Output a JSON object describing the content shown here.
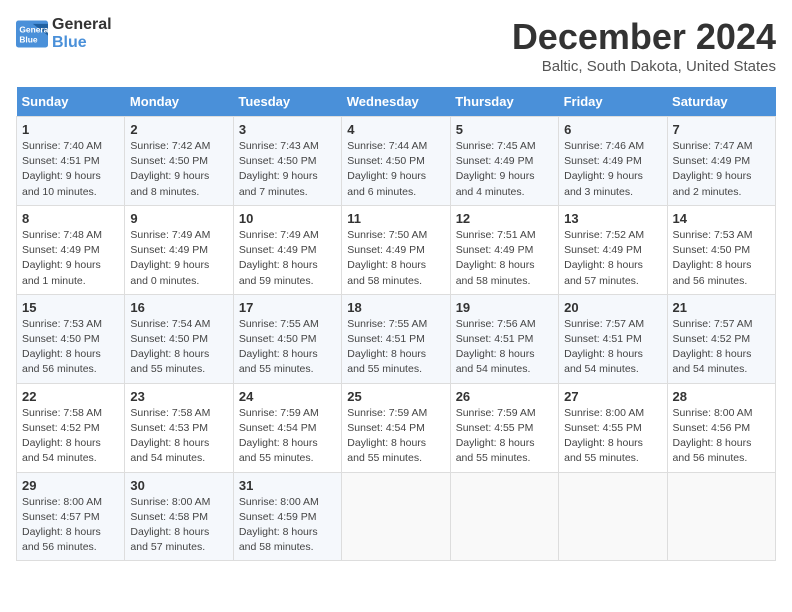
{
  "header": {
    "logo_line1": "General",
    "logo_line2": "Blue",
    "title": "December 2024",
    "subtitle": "Baltic, South Dakota, United States"
  },
  "days_of_week": [
    "Sunday",
    "Monday",
    "Tuesday",
    "Wednesday",
    "Thursday",
    "Friday",
    "Saturday"
  ],
  "weeks": [
    [
      {
        "day": 1,
        "info": "Sunrise: 7:40 AM\nSunset: 4:51 PM\nDaylight: 9 hours and 10 minutes."
      },
      {
        "day": 2,
        "info": "Sunrise: 7:42 AM\nSunset: 4:50 PM\nDaylight: 9 hours and 8 minutes."
      },
      {
        "day": 3,
        "info": "Sunrise: 7:43 AM\nSunset: 4:50 PM\nDaylight: 9 hours and 7 minutes."
      },
      {
        "day": 4,
        "info": "Sunrise: 7:44 AM\nSunset: 4:50 PM\nDaylight: 9 hours and 6 minutes."
      },
      {
        "day": 5,
        "info": "Sunrise: 7:45 AM\nSunset: 4:49 PM\nDaylight: 9 hours and 4 minutes."
      },
      {
        "day": 6,
        "info": "Sunrise: 7:46 AM\nSunset: 4:49 PM\nDaylight: 9 hours and 3 minutes."
      },
      {
        "day": 7,
        "info": "Sunrise: 7:47 AM\nSunset: 4:49 PM\nDaylight: 9 hours and 2 minutes."
      }
    ],
    [
      {
        "day": 8,
        "info": "Sunrise: 7:48 AM\nSunset: 4:49 PM\nDaylight: 9 hours and 1 minute."
      },
      {
        "day": 9,
        "info": "Sunrise: 7:49 AM\nSunset: 4:49 PM\nDaylight: 9 hours and 0 minutes."
      },
      {
        "day": 10,
        "info": "Sunrise: 7:49 AM\nSunset: 4:49 PM\nDaylight: 8 hours and 59 minutes."
      },
      {
        "day": 11,
        "info": "Sunrise: 7:50 AM\nSunset: 4:49 PM\nDaylight: 8 hours and 58 minutes."
      },
      {
        "day": 12,
        "info": "Sunrise: 7:51 AM\nSunset: 4:49 PM\nDaylight: 8 hours and 58 minutes."
      },
      {
        "day": 13,
        "info": "Sunrise: 7:52 AM\nSunset: 4:49 PM\nDaylight: 8 hours and 57 minutes."
      },
      {
        "day": 14,
        "info": "Sunrise: 7:53 AM\nSunset: 4:50 PM\nDaylight: 8 hours and 56 minutes."
      }
    ],
    [
      {
        "day": 15,
        "info": "Sunrise: 7:53 AM\nSunset: 4:50 PM\nDaylight: 8 hours and 56 minutes."
      },
      {
        "day": 16,
        "info": "Sunrise: 7:54 AM\nSunset: 4:50 PM\nDaylight: 8 hours and 55 minutes."
      },
      {
        "day": 17,
        "info": "Sunrise: 7:55 AM\nSunset: 4:50 PM\nDaylight: 8 hours and 55 minutes."
      },
      {
        "day": 18,
        "info": "Sunrise: 7:55 AM\nSunset: 4:51 PM\nDaylight: 8 hours and 55 minutes."
      },
      {
        "day": 19,
        "info": "Sunrise: 7:56 AM\nSunset: 4:51 PM\nDaylight: 8 hours and 54 minutes."
      },
      {
        "day": 20,
        "info": "Sunrise: 7:57 AM\nSunset: 4:51 PM\nDaylight: 8 hours and 54 minutes."
      },
      {
        "day": 21,
        "info": "Sunrise: 7:57 AM\nSunset: 4:52 PM\nDaylight: 8 hours and 54 minutes."
      }
    ],
    [
      {
        "day": 22,
        "info": "Sunrise: 7:58 AM\nSunset: 4:52 PM\nDaylight: 8 hours and 54 minutes."
      },
      {
        "day": 23,
        "info": "Sunrise: 7:58 AM\nSunset: 4:53 PM\nDaylight: 8 hours and 54 minutes."
      },
      {
        "day": 24,
        "info": "Sunrise: 7:59 AM\nSunset: 4:54 PM\nDaylight: 8 hours and 55 minutes."
      },
      {
        "day": 25,
        "info": "Sunrise: 7:59 AM\nSunset: 4:54 PM\nDaylight: 8 hours and 55 minutes."
      },
      {
        "day": 26,
        "info": "Sunrise: 7:59 AM\nSunset: 4:55 PM\nDaylight: 8 hours and 55 minutes."
      },
      {
        "day": 27,
        "info": "Sunrise: 8:00 AM\nSunset: 4:55 PM\nDaylight: 8 hours and 55 minutes."
      },
      {
        "day": 28,
        "info": "Sunrise: 8:00 AM\nSunset: 4:56 PM\nDaylight: 8 hours and 56 minutes."
      }
    ],
    [
      {
        "day": 29,
        "info": "Sunrise: 8:00 AM\nSunset: 4:57 PM\nDaylight: 8 hours and 56 minutes."
      },
      {
        "day": 30,
        "info": "Sunrise: 8:00 AM\nSunset: 4:58 PM\nDaylight: 8 hours and 57 minutes."
      },
      {
        "day": 31,
        "info": "Sunrise: 8:00 AM\nSunset: 4:59 PM\nDaylight: 8 hours and 58 minutes."
      },
      null,
      null,
      null,
      null
    ]
  ]
}
